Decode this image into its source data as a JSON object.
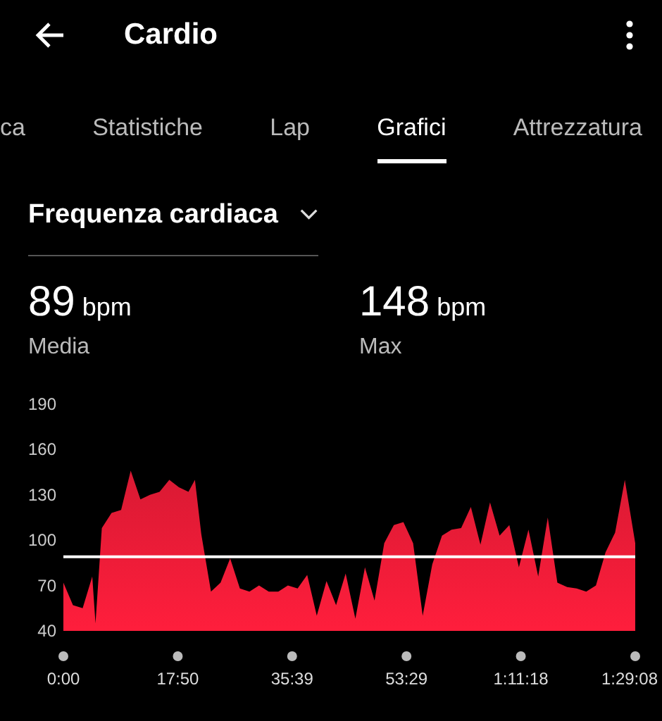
{
  "header": {
    "title": "Cardio"
  },
  "tabs": [
    {
      "label": "ca",
      "selected": false
    },
    {
      "label": "Statistiche",
      "selected": false
    },
    {
      "label": "Lap",
      "selected": false
    },
    {
      "label": "Grafici",
      "selected": true
    },
    {
      "label": "Attrezzatura",
      "selected": false
    }
  ],
  "metric_selector": {
    "value": "Frequenza cardiaca"
  },
  "stats": [
    {
      "value": "89",
      "unit": "bpm",
      "label": "Media"
    },
    {
      "value": "148",
      "unit": "bpm",
      "label": "Max"
    }
  ],
  "chart": {
    "chart_data": {
      "type": "area",
      "x": [
        0,
        1.5,
        3,
        4.5,
        5,
        6,
        7.5,
        9,
        10.5,
        12,
        13.5,
        15,
        16.5,
        18,
        19.5,
        20.5,
        21.5,
        23,
        24.5,
        26,
        27.5,
        29,
        30.5,
        32,
        33.5,
        35,
        36.5,
        38,
        39.5,
        41,
        42.5,
        44,
        45.5,
        47,
        48.5,
        50,
        51.5,
        53,
        54.5,
        56,
        57.5,
        59,
        60.5,
        62,
        63.5,
        65,
        66.5,
        68,
        69.5,
        71,
        72.5,
        74,
        75.5,
        77,
        78.5,
        80,
        81.5,
        83,
        84.5,
        86,
        87.5,
        89.13
      ],
      "series": [
        {
          "color": "#ff1e3c",
          "values": [
            72,
            57,
            55,
            76,
            45,
            108,
            118,
            120,
            146,
            127,
            130,
            132,
            140,
            135,
            132,
            140,
            104,
            66,
            72,
            88,
            68,
            66,
            70,
            66,
            66,
            70,
            68,
            77,
            50,
            73,
            57,
            78,
            48,
            82,
            60,
            98,
            110,
            112,
            98,
            50,
            84,
            103,
            107,
            108,
            122,
            97,
            125,
            103,
            110,
            82,
            107,
            76,
            115,
            72,
            69,
            68,
            66,
            70,
            92,
            105,
            140,
            98
          ]
        }
      ],
      "ylim": [
        40,
        190
      ],
      "yticks": [
        40,
        70,
        100,
        130,
        160,
        190
      ],
      "xlim": [
        0,
        89.13
      ],
      "xticks": [
        {
          "value": 0,
          "label": "0:00"
        },
        {
          "value": 17.83,
          "label": "17:50"
        },
        {
          "value": 35.65,
          "label": "35:39"
        },
        {
          "value": 53.48,
          "label": "53:29"
        },
        {
          "value": 71.3,
          "label": "1:11:18"
        },
        {
          "value": 89.13,
          "label": "1:29:08"
        }
      ],
      "ref_lines": [
        {
          "axis": "y",
          "value": 89
        }
      ]
    }
  }
}
